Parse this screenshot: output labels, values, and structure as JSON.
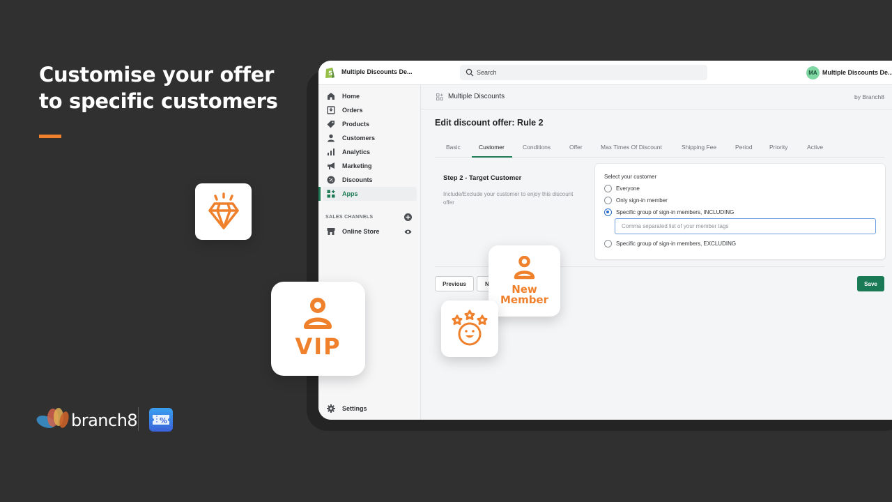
{
  "hero": {
    "headline_line1": "Customise your offer",
    "headline_line2": "to specific customers",
    "accent_color": "#f0812c"
  },
  "topbar": {
    "store_name": "Multiple Discounts De...",
    "search_placeholder": "Search",
    "avatar_initials": "MA",
    "account_name": "Multiple Discounts De..."
  },
  "sidebar": {
    "items": [
      {
        "label": "Home",
        "icon": "home-icon"
      },
      {
        "label": "Orders",
        "icon": "orders-icon"
      },
      {
        "label": "Products",
        "icon": "tag-icon"
      },
      {
        "label": "Customers",
        "icon": "person-icon"
      },
      {
        "label": "Analytics",
        "icon": "bar-chart-icon"
      },
      {
        "label": "Marketing",
        "icon": "megaphone-icon"
      },
      {
        "label": "Discounts",
        "icon": "discount-icon"
      },
      {
        "label": "Apps",
        "icon": "apps-icon",
        "active": true
      }
    ],
    "sales_channels_heading": "SALES CHANNELS",
    "online_store_label": "Online Store",
    "settings_label": "Settings"
  },
  "app_header": {
    "title": "Multiple Discounts",
    "by": "by Branch8"
  },
  "page": {
    "title": "Edit discount offer: Rule 2",
    "tabs": [
      {
        "label": "Basic"
      },
      {
        "label": "Customer",
        "active": true
      },
      {
        "label": "Conditions"
      },
      {
        "label": "Offer"
      },
      {
        "label": "Max Times Of Discount"
      },
      {
        "label": "Shipping Fee"
      },
      {
        "label": "Period"
      },
      {
        "label": "Priority"
      },
      {
        "label": "Active"
      }
    ],
    "step_title": "Step 2 - Target Customer",
    "step_description": "Include/Exclude your customer to enjoy this discount offer"
  },
  "customer_card": {
    "label": "Select your customer",
    "options": [
      {
        "label": "Everyone",
        "checked": false
      },
      {
        "label": "Only sign-in member",
        "checked": false
      },
      {
        "label": "Specific group of sign-in members, INCLUDING",
        "checked": true
      },
      {
        "label": "Specific group of sign-in members, EXCLUDING",
        "checked": false
      }
    ],
    "tags_input_value": "",
    "tags_input_placeholder": "Comma separated list of your member tags"
  },
  "actions": {
    "previous_label": "Previous",
    "next_label_visible": "N",
    "save_label": "Save",
    "save_color": "#1b7a56"
  },
  "tiles": {
    "vip_label": "VIP",
    "new_member_line1": "New",
    "new_member_line2": "Member"
  },
  "footer": {
    "brand_name": "branch8"
  }
}
